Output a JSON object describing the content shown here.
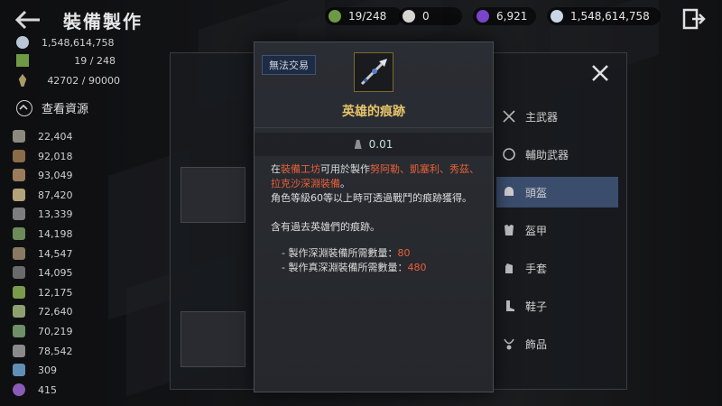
{
  "header": {
    "title": "裝備製作"
  },
  "currencies": [
    {
      "icon": "green-gem-icon",
      "color": "#6f9a45",
      "value": "19/248"
    },
    {
      "icon": "pearl-icon",
      "color": "#d9d6d0",
      "value": "0"
    },
    {
      "icon": "purple-orb-icon",
      "color": "#7b45c9",
      "value": "6,921"
    },
    {
      "icon": "silver-coin-icon",
      "color": "#c8d6e6",
      "value": "1,548,614,758"
    }
  ],
  "left_summary": [
    {
      "icon": "silver-coin-icon",
      "value": "1,548,614,758"
    },
    {
      "icon": "green-gem-icon",
      "value": "19 / 248"
    },
    {
      "icon": "wheat-icon",
      "value": "42702 / 90000"
    }
  ],
  "view_resources_label": "查看資源",
  "resources": [
    "22,404",
    "92,018",
    "93,049",
    "87,420",
    "13,339",
    "14,198",
    "14,547",
    "14,095",
    "12,175",
    "72,640",
    "70,219",
    "78,542",
    "309",
    "415"
  ],
  "categories": [
    {
      "icon": "crossed-swords-icon",
      "label": "主武器",
      "selected": false
    },
    {
      "icon": "shield-icon",
      "label": "輔助武器",
      "selected": false
    },
    {
      "icon": "helmet-icon",
      "label": "頭盔",
      "selected": true
    },
    {
      "icon": "armor-icon",
      "label": "盔甲",
      "selected": false
    },
    {
      "icon": "gloves-icon",
      "label": "手套",
      "selected": false
    },
    {
      "icon": "boots-icon",
      "label": "鞋子",
      "selected": false
    },
    {
      "icon": "necklace-icon",
      "label": "飾品",
      "selected": false
    }
  ],
  "popup": {
    "badge": "無法交易",
    "title": "英雄的痕跡",
    "weight": "0.01",
    "desc": {
      "p1_a": "在",
      "p1_hl1": "裝備工坊",
      "p1_b": "可用於製作",
      "p1_hl2": "努阿勒、凱塞利、秀茲、拉克沙深淵裝備",
      "p1_c": "。",
      "p2": "角色等級60等以上時可透過戰鬥的痕跡獲得。",
      "p3": "含有過去英雄們的痕跡。",
      "b1_label": "- 製作深淵裝備所需數量：",
      "b1_value": "80",
      "b2_label": "- 製作真深淵裝備所需數量：",
      "b2_value": "480"
    }
  }
}
